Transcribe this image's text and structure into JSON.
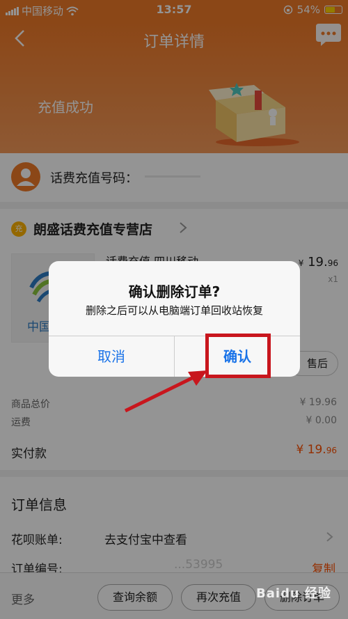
{
  "status_bar": {
    "carrier": "中国移动",
    "time": "13:57",
    "battery": "54%",
    "battery_level": 0.54
  },
  "header": {
    "title": "订单详情",
    "success_text": "充值成功"
  },
  "phone": {
    "label": "话费充值号码：",
    "number_masked": ""
  },
  "store": {
    "icon_text": "充",
    "name": "朗盛话费充值专营店",
    "product_title": "话费充值 四川移动",
    "logo_text": "中国",
    "price_currency": "¥",
    "price_int": " 19.",
    "price_dec": "96",
    "quantity": "x1",
    "aftersale_label": "售后"
  },
  "summary": {
    "goods_total_label": "商品总价",
    "goods_total_value": "¥ 19.96",
    "shipping_label": "运费",
    "shipping_value": "¥ 0.00",
    "paid_label": "实付款",
    "paid_value_int": "¥ 19.",
    "paid_value_dec": "96"
  },
  "order_info": {
    "title": "订单信息",
    "huabei_label": "花呗账单:",
    "huabei_value": "去支付宝中查看",
    "order_no_label": "订单编号:",
    "order_no_partial": "...53995",
    "copy_label": "复制"
  },
  "bottom": {
    "more": "更多",
    "btn_balance": "查询余额",
    "btn_recharge": "再次充值",
    "btn_delete": "删除订单"
  },
  "dialog": {
    "title": "确认删除订单?",
    "message": "删除之后可以从电脑端订单回收站恢复",
    "cancel": "取消",
    "confirm": "确认"
  },
  "watermark": "Baidu 经验",
  "colors": {
    "accent": "#f07a28",
    "link_blue": "#1a73e8",
    "highlight_red": "#c8161d",
    "price_orange": "#ff5000"
  }
}
